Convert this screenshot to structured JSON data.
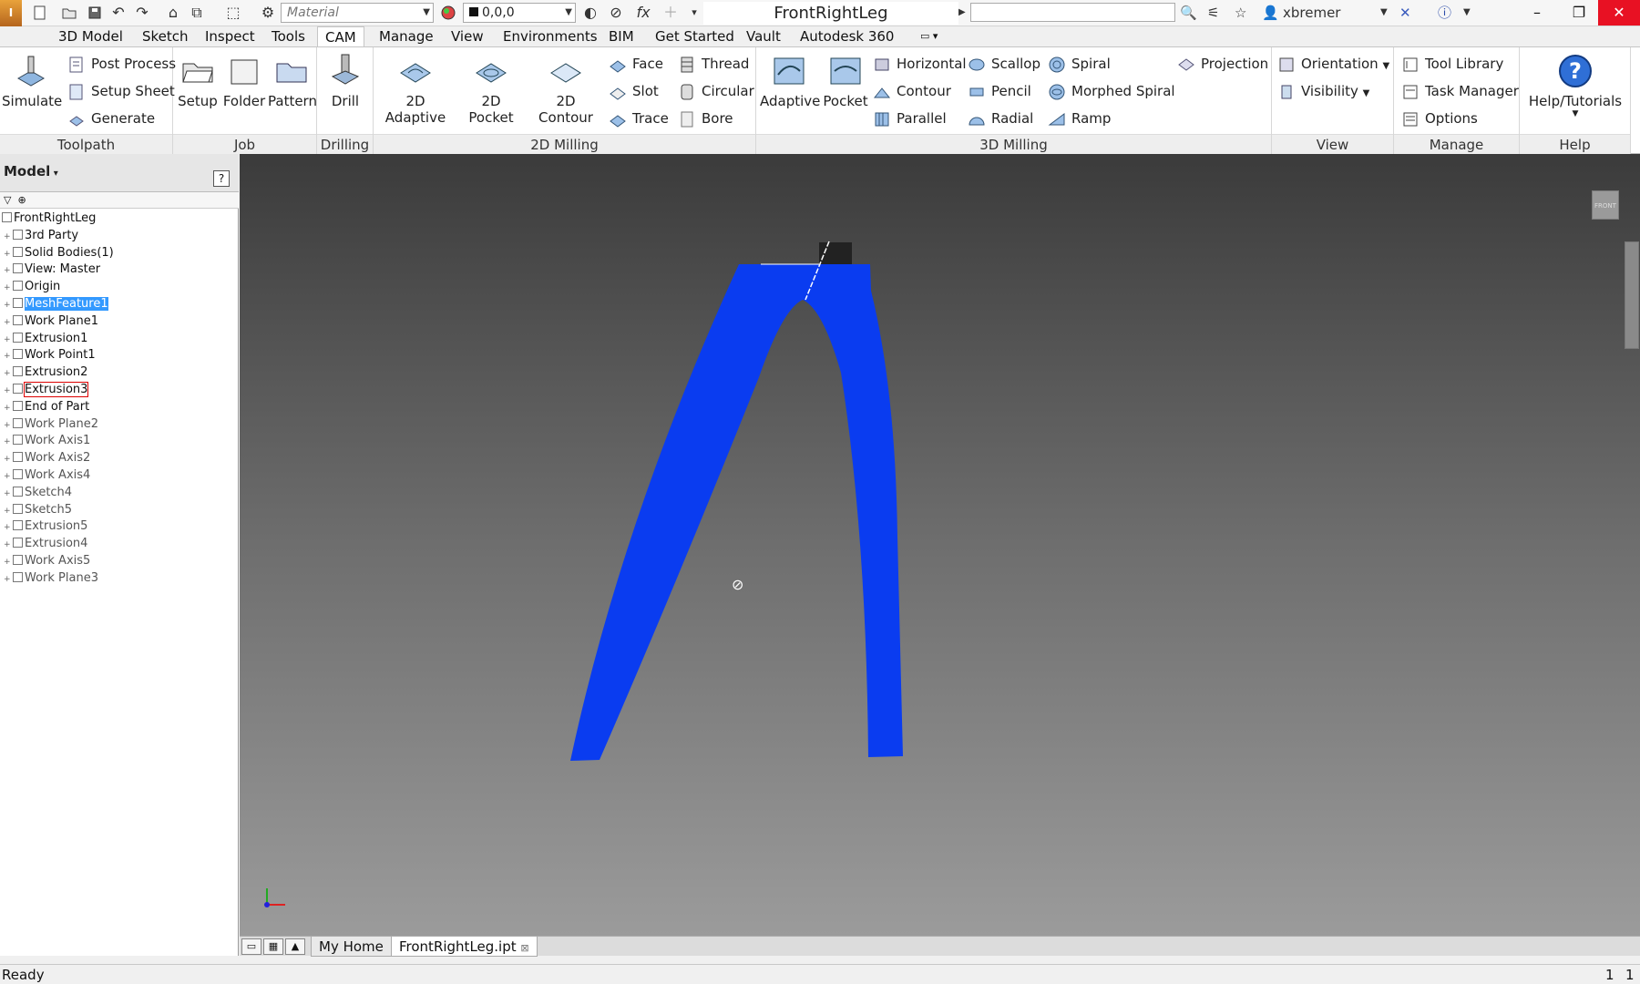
{
  "titlebar": {
    "app_button": "I",
    "material_combo": "Material",
    "appearance_combo": "0,0,0",
    "document_title": "FrontRightLeg",
    "user": "xbremer",
    "formula_icon": "fx"
  },
  "menu_tabs": [
    "3D Model",
    "Sketch",
    "Inspect",
    "Tools",
    "CAM",
    "Manage",
    "View",
    "Environments",
    "BIM",
    "Get Started",
    "Vault",
    "Autodesk 360"
  ],
  "active_tab": "CAM",
  "ribbon": {
    "toolpath": {
      "title": "Toolpath",
      "simulate": "Simulate",
      "post_process": "Post Process",
      "setup_sheet": "Setup Sheet",
      "generate": "Generate"
    },
    "job": {
      "title": "Job",
      "setup": "Setup",
      "folder": "Folder",
      "pattern": "Pattern"
    },
    "drilling": {
      "title": "Drilling",
      "drill": "Drill"
    },
    "milling2d": {
      "title": "2D Milling",
      "adaptive": "2D Adaptive",
      "pocket": "2D Pocket",
      "contour": "2D Contour",
      "face": "Face",
      "slot": "Slot",
      "trace": "Trace",
      "thread": "Thread",
      "circular": "Circular",
      "bore": "Bore"
    },
    "milling3d": {
      "title": "3D Milling",
      "adaptive": "Adaptive",
      "pocket": "Pocket",
      "horizontal": "Horizontal",
      "contour": "Contour",
      "parallel": "Parallel",
      "scallop": "Scallop",
      "pencil": "Pencil",
      "radial": "Radial",
      "spiral": "Spiral",
      "morphed_spiral": "Morphed Spiral",
      "ramp": "Ramp",
      "projection": "Projection"
    },
    "view": {
      "title": "View",
      "orientation": "Orientation",
      "visibility": "Visibility"
    },
    "manage": {
      "title": "Manage",
      "tool_library": "Tool Library",
      "task_manager": "Task Manager",
      "options": "Options"
    },
    "help": {
      "title": "Help",
      "help_tutorials": "Help/Tutorials"
    }
  },
  "browser": {
    "title": "Model",
    "help_glyph": "?",
    "tree": [
      {
        "label": "FrontRightLeg",
        "dim": false
      },
      {
        "label": "3rd Party",
        "dim": false
      },
      {
        "label": "Solid Bodies(1)",
        "dim": false
      },
      {
        "label": "View: Master",
        "dim": false
      },
      {
        "label": "Origin",
        "dim": false
      },
      {
        "label": "MeshFeature1",
        "dim": false
      },
      {
        "label": "Work Plane1",
        "dim": false
      },
      {
        "label": "Extrusion1",
        "dim": false
      },
      {
        "label": "Work Point1",
        "dim": false
      },
      {
        "label": "Extrusion2",
        "dim": false
      },
      {
        "label": "Extrusion3",
        "dim": false
      },
      {
        "label": "End of Part",
        "dim": false
      },
      {
        "label": "Work Plane2",
        "dim": true
      },
      {
        "label": "Work Axis1",
        "dim": true
      },
      {
        "label": "Work Axis2",
        "dim": true
      },
      {
        "label": "Work Axis4",
        "dim": true
      },
      {
        "label": "Sketch4",
        "dim": true
      },
      {
        "label": "Sketch5",
        "dim": true
      },
      {
        "label": "Extrusion5",
        "dim": true
      },
      {
        "label": "Extrusion4",
        "dim": true
      },
      {
        "label": "Work Axis5",
        "dim": true
      },
      {
        "label": "Work Plane3",
        "dim": true
      }
    ],
    "selected": "MeshFeature1",
    "error_item": "Extrusion3"
  },
  "viewport": {
    "viewcube_label": "FRONT",
    "model_color": "#0a3cf0"
  },
  "doc_tabs": [
    "My Home",
    "FrontRightLeg.ipt"
  ],
  "active_doc_tab": "FrontRightLeg.ipt",
  "status": {
    "text": "Ready",
    "count_a": "1",
    "count_b": "1"
  }
}
